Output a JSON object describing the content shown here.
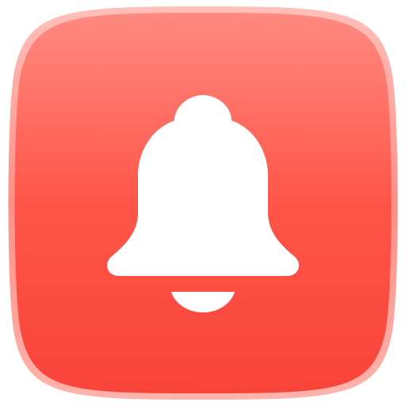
{
  "icon": {
    "name": "bell-icon",
    "colors": {
      "tile_top": "#ff8a80",
      "tile_mid": "#ff5549",
      "tile_bottom": "#f9443a",
      "tile_rim": "#ffb3ac",
      "glyph": "#ffffff"
    }
  }
}
